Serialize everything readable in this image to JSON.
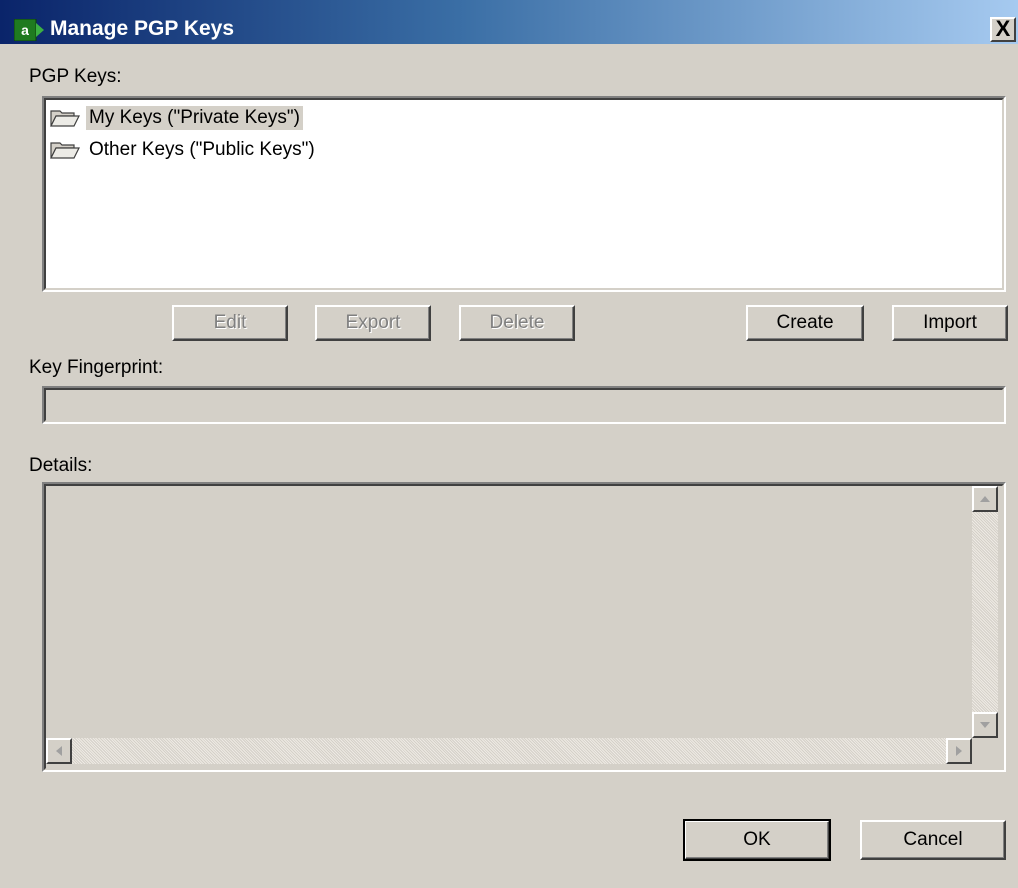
{
  "window": {
    "title": "Manage PGP Keys",
    "close_glyph": "X"
  },
  "keys_section": {
    "label": "PGP Keys:",
    "items": [
      {
        "label": "My Keys (\"Private Keys\")",
        "icon": "folder-open-icon",
        "selected": true
      },
      {
        "label": "Other Keys (\"Public Keys\")",
        "icon": "folder-open-icon",
        "selected": false
      }
    ]
  },
  "key_buttons": {
    "edit": "Edit",
    "export": "Export",
    "delete": "Delete",
    "create": "Create",
    "import": "Import"
  },
  "fingerprint": {
    "label": "Key Fingerprint:",
    "value": ""
  },
  "details": {
    "label": "Details:",
    "value": ""
  },
  "footer": {
    "ok": "OK",
    "cancel": "Cancel"
  },
  "colors": {
    "face": "#d4d0c8",
    "title_start": "#0a246a",
    "title_end": "#a6caf0",
    "app_icon": "#2e8b2e"
  }
}
